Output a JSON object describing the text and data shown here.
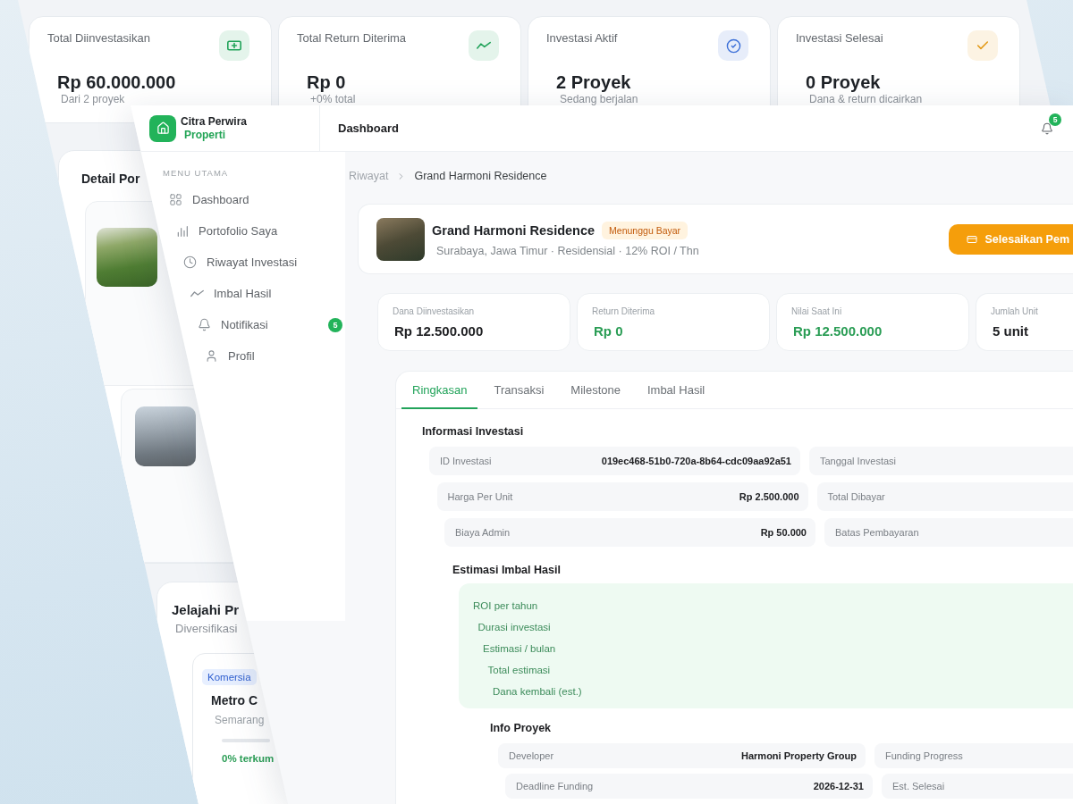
{
  "background_window": {
    "stats": [
      {
        "label": "Total Diinvestasikan",
        "value": "Rp 60.000.000",
        "note": "Dari 2 proyek",
        "color": "#22a35a"
      },
      {
        "label": "Total Return Diterima",
        "value": "Rp 0",
        "note": "+0% total",
        "color": "#22a35a"
      },
      {
        "label": "Investasi Aktif",
        "value": "2 Proyek",
        "note": "Sedang berjalan",
        "color": "#3b6fd8"
      },
      {
        "label": "Investasi Selesai",
        "value": "0 Proyek",
        "note": "Dana & return dicairkan",
        "color": "#e39b1b"
      }
    ],
    "portfolio": {
      "title": "Detail Por"
    },
    "explore": {
      "title": "Jelajahi Pr",
      "subtitle": "Diversifikasi",
      "project": {
        "tag": "Komersia",
        "name": "Metro C",
        "location": "Semarang",
        "funding": {
          "level": 0
        },
        "funding_text": "0% terkum"
      }
    }
  },
  "app": {
    "brand": {
      "name": "Citra Perwira",
      "tagline": "Properti"
    },
    "page_title": "Dashboard",
    "notification_count": "5",
    "menu_heading": "MENU UTAMA",
    "menu": [
      {
        "label": "Dashboard"
      },
      {
        "label": "Portofolio Saya"
      },
      {
        "label": "Riwayat Investasi"
      },
      {
        "label": "Imbal Hasil"
      },
      {
        "label": "Notifikasi",
        "badge": "5"
      },
      {
        "label": "Profil"
      }
    ],
    "breadcrumb": [
      "Riwayat",
      "Grand Harmoni Residence"
    ],
    "project": {
      "name": "Grand Harmoni Residence",
      "status": "Menunggu Bayar",
      "meta": "Surabaya, Jawa Timur · Residensial · 12% ROI / Thn",
      "action": "Selesaikan Pem"
    },
    "summary": [
      {
        "label": "Dana Diinvestasikan",
        "value": "Rp 12.500.000",
        "kind": "plain"
      },
      {
        "label": "Return Diterima",
        "value": "Rp 0",
        "kind": "positive"
      },
      {
        "label": "Nilai Saat Ini",
        "value": "Rp 12.500.000",
        "kind": "positive"
      },
      {
        "label": "Jumlah Unit",
        "value": "5 unit",
        "kind": "plain"
      }
    ],
    "tabs": [
      {
        "label": "Ringkasan",
        "selected": true
      },
      {
        "label": "Transaksi",
        "selected": false
      },
      {
        "label": "Milestone",
        "selected": false
      },
      {
        "label": "Imbal Hasil",
        "selected": false
      }
    ],
    "investment_info": {
      "title": "Informasi Investasi",
      "rows": [
        [
          {
            "label": "ID Investasi",
            "value": "019ec468-51b0-720a-8b64-cdc09aa92a51"
          },
          {
            "label": "Tanggal Investasi"
          }
        ],
        [
          {
            "label": "Harga Per Unit",
            "value": "Rp 2.500.000"
          },
          {
            "label": "Total Dibayar"
          }
        ],
        [
          {
            "label": "Biaya Admin",
            "value": "Rp 50.000"
          },
          {
            "label": "Batas Pembayaran"
          }
        ]
      ]
    },
    "return_estimate": {
      "title": "Estimasi Imbal Hasil",
      "rows": [
        "ROI per tahun",
        "Durasi investasi",
        "Estimasi / bulan",
        "Total estimasi",
        "Dana kembali (est.)"
      ]
    },
    "project_info": {
      "title": "Info Proyek",
      "rows": [
        [
          {
            "label": "Developer",
            "value": "Harmoni Property Group"
          },
          {
            "label": "Funding Progress"
          }
        ],
        [
          {
            "label": "Deadline Funding",
            "value": "2026-12-31"
          },
          {
            "label": "Est. Selesai"
          }
        ]
      ]
    }
  }
}
